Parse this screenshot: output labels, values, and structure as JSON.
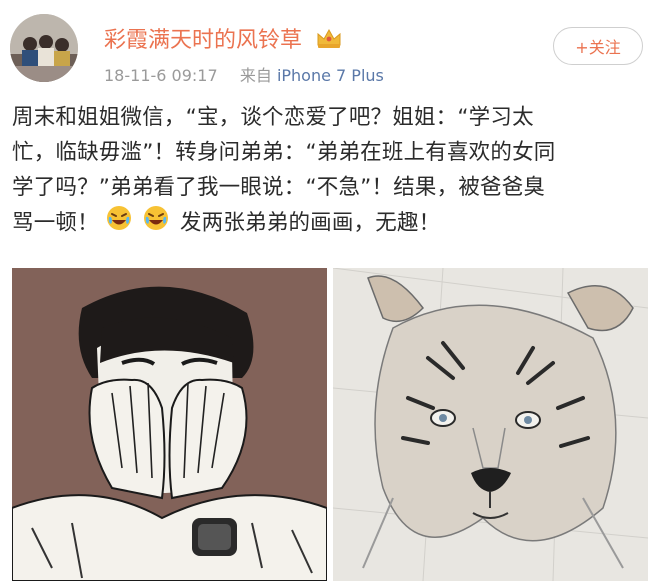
{
  "post": {
    "username": "彩霞满天时的风铃草",
    "timestamp": "18-11-6 09:17",
    "source_prefix": "来自",
    "source_device": "iPhone 7 Plus",
    "follow_label": "+关注",
    "text_lines": [
      "周末和姐姐微信，“宝，谈个恋爱了吧？姐姐：“学习太",
      "忙，临缺毋滥”！转身问弟弟：“弟弟在班上有喜欢的女同",
      "学了吗？”弟弟看了我一眼说：“不急”！结果，被爸爸臭",
      "发两张弟弟的画画，无趣！"
    ],
    "line4_prefix": "骂一顿！",
    "emojis": [
      "crying-laughing-emoji",
      "crying-laughing-emoji"
    ],
    "images": [
      "boy-covering-face-drawing",
      "tiger-pencil-drawing"
    ]
  },
  "colors": {
    "username": "#eb7350",
    "meta": "#9a9a9a",
    "link": "#5a78a8",
    "text": "#2b2b2b"
  }
}
